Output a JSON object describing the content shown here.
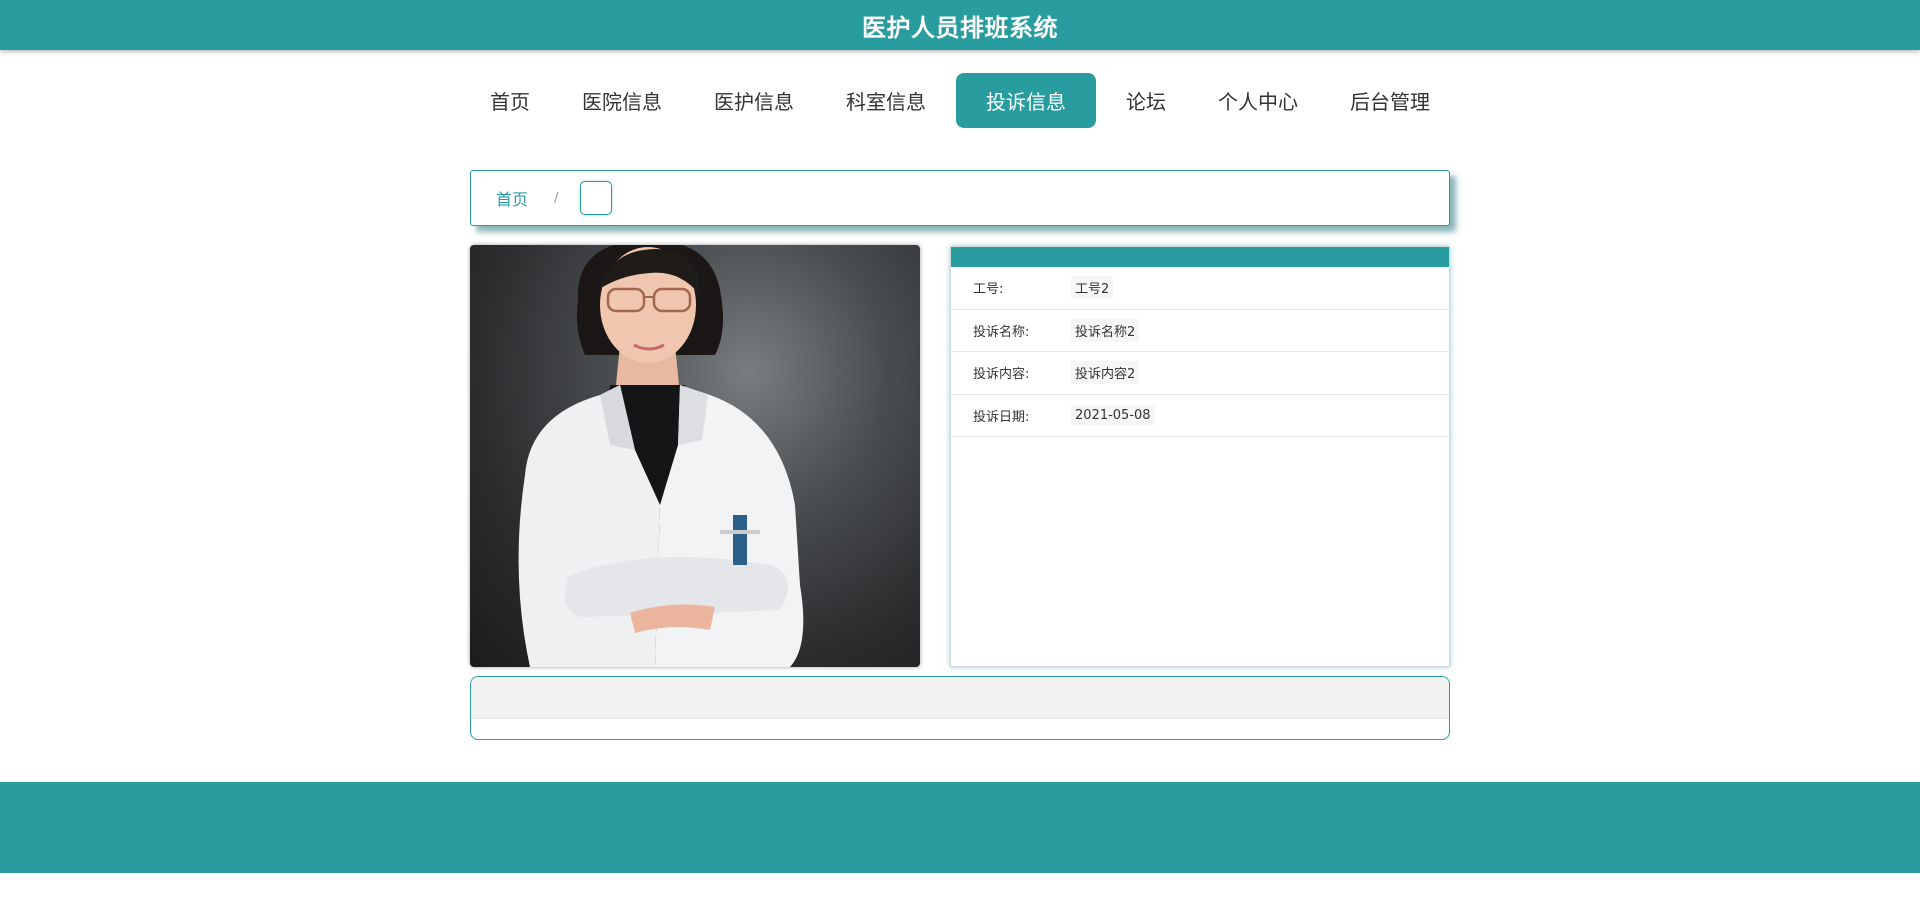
{
  "header": {
    "title": "医护人员排班系统"
  },
  "nav": {
    "items": [
      {
        "label": "首页",
        "active": false
      },
      {
        "label": "医院信息",
        "active": false
      },
      {
        "label": "医护信息",
        "active": false
      },
      {
        "label": "科室信息",
        "active": false
      },
      {
        "label": "投诉信息",
        "active": true
      },
      {
        "label": "论坛",
        "active": false
      },
      {
        "label": "个人中心",
        "active": false
      },
      {
        "label": "后台管理",
        "active": false
      }
    ]
  },
  "breadcrumb": {
    "home": "首页",
    "separator": "/"
  },
  "detail": {
    "rows": [
      {
        "label": "工号:",
        "value": "工号2"
      },
      {
        "label": "投诉名称:",
        "value": "投诉名称2"
      },
      {
        "label": "投诉内容:",
        "value": "投诉内容2"
      },
      {
        "label": "投诉日期:",
        "value": "2021-05-08"
      }
    ]
  },
  "colors": {
    "primary": "#289c9f",
    "footer": "#289c9f"
  }
}
